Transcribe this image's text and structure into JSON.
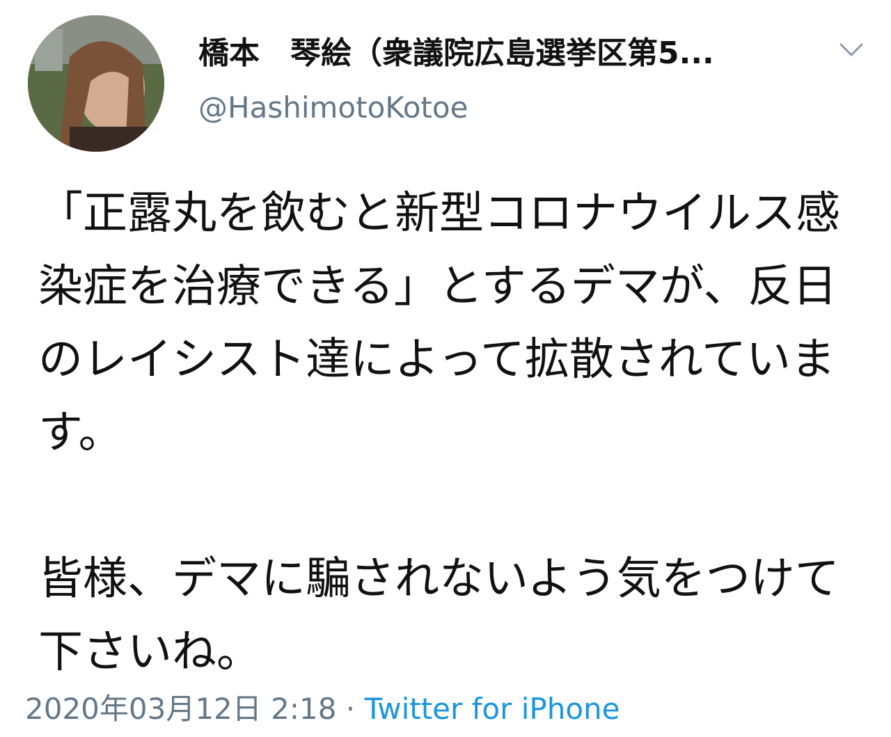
{
  "tweet": {
    "author": {
      "display_name": "橋本　琴絵（衆議院広島選挙区第5...",
      "handle": "@HashimotoKotoe"
    },
    "menu_icon": "chevron-down-icon",
    "body": "「正露丸を飲むと新型コロナウイルス感染症を治療できる」とするデマが、反日のレイシスト達によって拡散されています。\n\n皆様、デマに騙されないよう気をつけて下さいね。",
    "timestamp": "2020年03月12日 2:18",
    "separator": " · ",
    "source": "Twitter for iPhone",
    "colors": {
      "handle": "#657786",
      "source_link": "#1b95e0"
    }
  }
}
